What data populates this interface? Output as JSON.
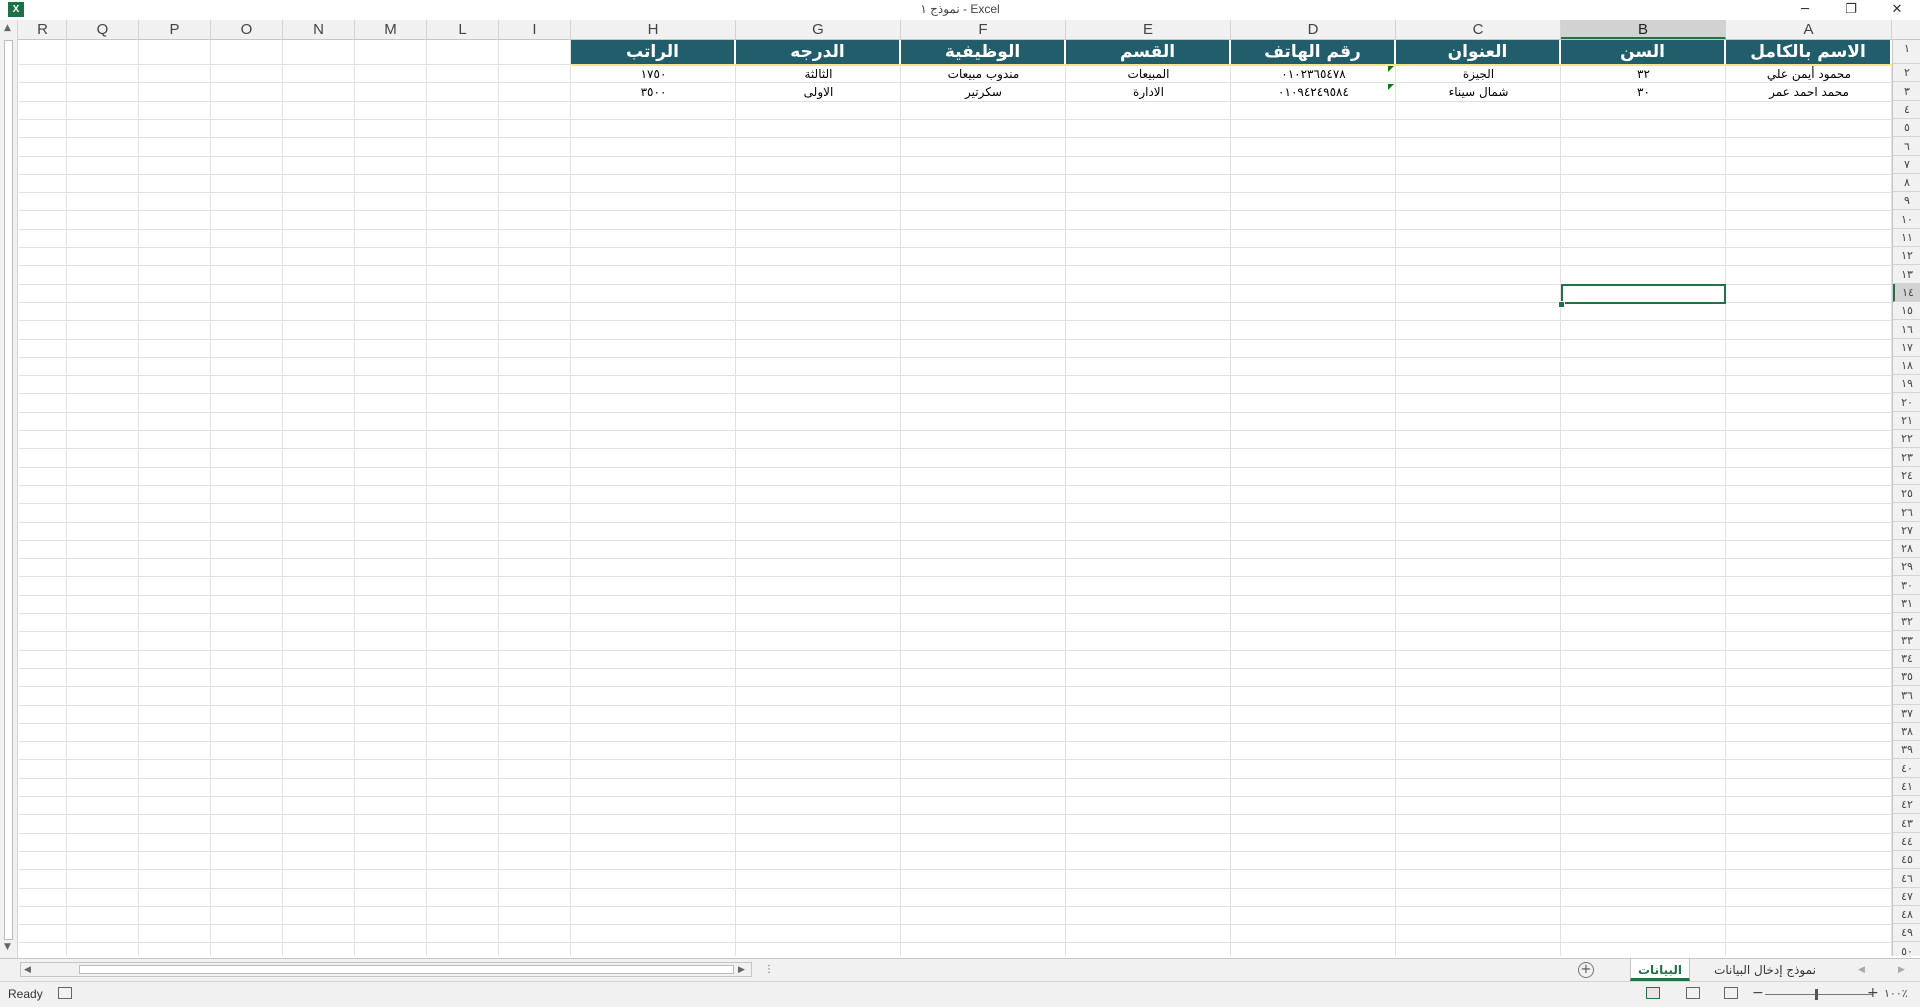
{
  "window": {
    "title": "نموذج ١ - Excel",
    "logo_text": "X",
    "minimize_glyph": "─",
    "restore_glyph": "❐",
    "close_glyph": "✕"
  },
  "columns": [
    "A",
    "B",
    "C",
    "D",
    "E",
    "F",
    "G",
    "H",
    "I",
    "L",
    "M",
    "N",
    "O",
    "P",
    "Q",
    "R"
  ],
  "selected_column": "B",
  "row_numbers": [
    "١",
    "٢",
    "٣",
    "٤",
    "٥",
    "٦",
    "٧",
    "٨",
    "٩",
    "١٠",
    "١١",
    "١٢",
    "١٣",
    "١٤",
    "١٥",
    "١٦",
    "١٧",
    "١٨",
    "١٩",
    "٢٠",
    "٢١",
    "٢٢",
    "٢٣",
    "٢٤",
    "٢٥",
    "٢٦",
    "٢٧",
    "٢٨",
    "٢٩",
    "٣٠",
    "٣١",
    "٣٢",
    "٣٣",
    "٣٤",
    "٣٥",
    "٣٦",
    "٣٧",
    "٣٨",
    "٣٩",
    "٤٠",
    "٤١",
    "٤٢",
    "٤٣",
    "٤٤",
    "٤٥",
    "٤٦",
    "٤٧",
    "٤٨",
    "٤٩",
    "٥٠"
  ],
  "selected_row": "١٤",
  "selected_cell": "B14",
  "table": {
    "header_color": "#215d6b",
    "headers": [
      "الاسم بالكامل",
      "السن",
      "العنوان",
      "رقم الهاتف",
      "القسم",
      "الوظيفية",
      "الدرجه",
      "الراتب"
    ],
    "rows": [
      [
        "محمود أيمن علي",
        "٣٢",
        "الجيزة",
        "٠١٠٢٣٦٥٤٧٨",
        "المبيعات",
        "مندوب مبيعات",
        "الثالثة",
        "١٧٥٠"
      ],
      [
        "محمد احمد عمر",
        "٣٠",
        "شمال سيناء",
        "٠١٠٩٤٢٤٩٥٨٤",
        "الادارة",
        "سكرتير",
        "الاولى",
        "٣٥٠٠"
      ]
    ]
  },
  "sheet_tabs": [
    {
      "label": "البيانات",
      "active": true
    },
    {
      "label": "نموذج إدخال البيانات",
      "active": false
    }
  ],
  "add_sheet_glyph": "+",
  "status": {
    "ready_text": "Ready",
    "zoom_text": "١٠٠٪",
    "zoom_minus": "−",
    "zoom_plus": "+"
  },
  "accent_color": "#217346"
}
